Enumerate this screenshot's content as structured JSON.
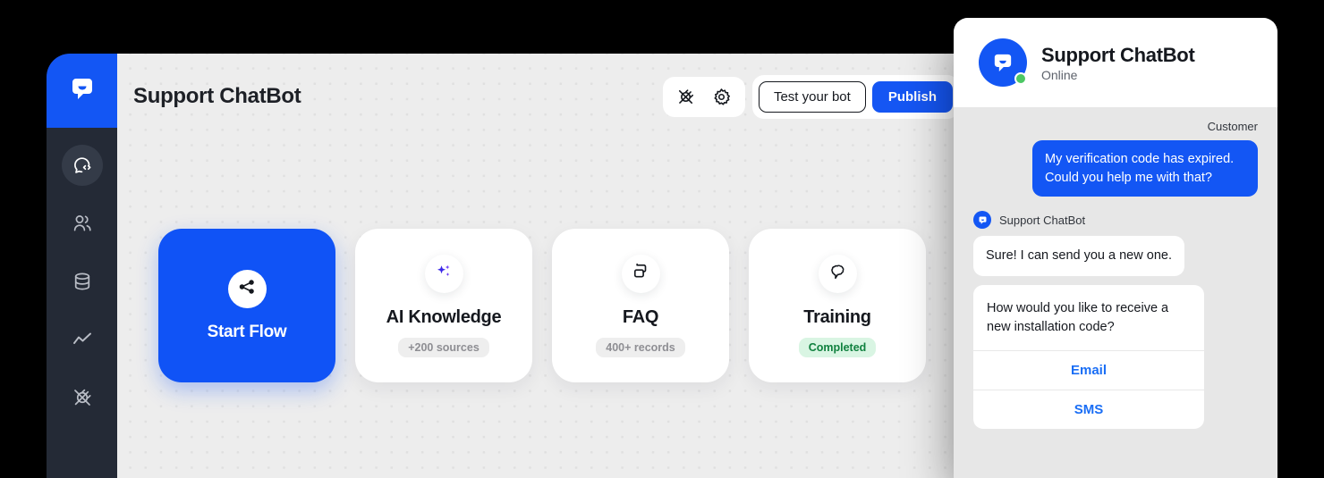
{
  "sidebar": {
    "brand_icon": "chatbot-logo-icon",
    "items": [
      {
        "icon": "chat-code-icon",
        "name": "bots",
        "active": true
      },
      {
        "icon": "users-icon",
        "name": "users",
        "active": false
      },
      {
        "icon": "database-icon",
        "name": "database",
        "active": false
      },
      {
        "icon": "analytics-line-icon",
        "name": "analytics",
        "active": false
      },
      {
        "icon": "plug-icon",
        "name": "integrations",
        "active": false
      }
    ]
  },
  "header": {
    "title": "Support ChatBot",
    "plug_icon": "plug-icon",
    "gear_icon": "gear-icon",
    "test_bot_label": "Test your bot",
    "publish_label": "Publish"
  },
  "cards": [
    {
      "title": "Start Flow",
      "icon": "share-nodes-icon",
      "badge": "",
      "primary": true
    },
    {
      "title": "AI Knowledge",
      "icon": "sparkles-icon",
      "badge": "+200 sources",
      "primary": false
    },
    {
      "title": "FAQ",
      "icon": "chat-bubbles-icon",
      "badge": "400+ records",
      "primary": false
    },
    {
      "title": "Training",
      "icon": "brain-bubble-icon",
      "badge": "Completed",
      "badge_style": "success",
      "primary": false
    }
  ],
  "chat": {
    "bot_name": "Support ChatBot",
    "status": "Online",
    "avatar_icon": "chatbot-avatar-icon",
    "customer_label": "Customer",
    "customer_message": "My verification code has expired. Could you help me with that?",
    "bot_label": "Support ChatBot",
    "bot_message_1": "Sure! I can send you a new one.",
    "bot_question": "How would you like to receive a new installation code?",
    "quick_replies": [
      "Email",
      "SMS"
    ]
  },
  "colors": {
    "brand_blue": "#1356f4",
    "publish_blue": "#1556f3",
    "sidebar_dark": "#242a36",
    "canvas_gray": "#ededed",
    "chat_bg": "#e7e7e7",
    "success_green": "#10813f",
    "online_green": "#4cc764",
    "sparkle_purple": "#4b28e0"
  }
}
